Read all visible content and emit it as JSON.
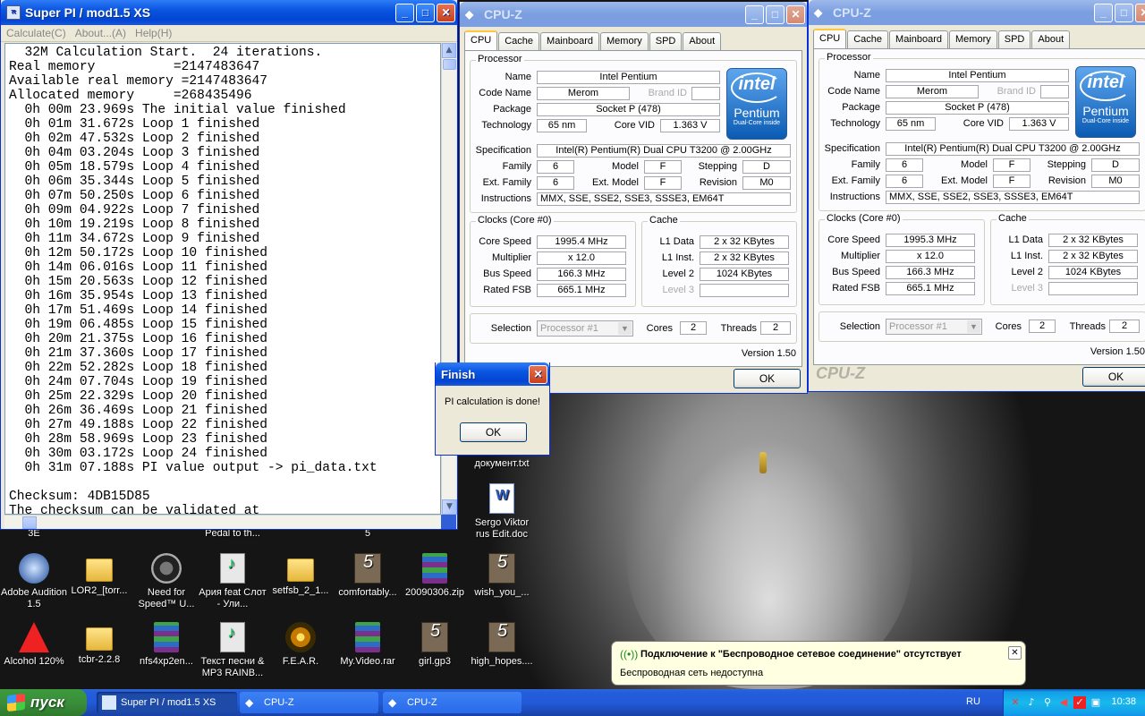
{
  "desktop": {
    "icons": [
      {
        "label": "Adobe Audition 1.5",
        "icon": "audition-icon"
      },
      {
        "label": "LOR2_[torr...",
        "icon": "folder-icon"
      },
      {
        "label": "Need for Speed™ U...",
        "icon": "nfs-icon"
      },
      {
        "label": "Ария feat Слот - Ули...",
        "icon": "mp3-icon"
      },
      {
        "label": "setfsb_2_1...",
        "icon": "folder-icon"
      },
      {
        "label": "comfortably...",
        "icon": "gp5-icon"
      },
      {
        "label": "20090306.zip",
        "icon": "rar-icon"
      },
      {
        "label": "wish_you_...",
        "icon": "gp5-icon"
      },
      {
        "label": "Alcohol 120%",
        "icon": "alcohol-icon"
      },
      {
        "label": "tcbr-2.2.8",
        "icon": "folder-icon"
      },
      {
        "label": "nfs4xp2en...",
        "icon": "rar-icon"
      },
      {
        "label": "Текст песни & MP3 RAINB...",
        "icon": "mp3-icon"
      },
      {
        "label": "F.E.A.R.",
        "icon": "fear-icon"
      },
      {
        "label": "My.Video.rar",
        "icon": "rar-icon"
      },
      {
        "label": "girl.gp3",
        "icon": "gp5-icon"
      },
      {
        "label": "high_hopes....",
        "icon": "gp5-icon"
      },
      {
        "label": "Sergo Viktor rus Edit.doc",
        "icon": "word-doc-icon"
      },
      {
        "label": "документ.txt",
        "icon": "txt-icon"
      }
    ],
    "partial_labels": [
      "3E",
      "Pedal to th...",
      "5"
    ]
  },
  "superpi": {
    "title": "Super PI / mod1.5 XS",
    "menu": [
      "Calculate(C)",
      "About...(A)",
      "Help(H)"
    ],
    "console_lines": [
      "  32M Calculation Start.  24 iterations.",
      "Real memory          =2147483647",
      "Available real memory =2147483647",
      "Allocated memory     =268435496",
      "  0h 00m 23.969s The initial value finished",
      "  0h 01m 31.672s Loop 1 finished",
      "  0h 02m 47.532s Loop 2 finished",
      "  0h 04m 03.204s Loop 3 finished",
      "  0h 05m 18.579s Loop 4 finished",
      "  0h 06m 35.344s Loop 5 finished",
      "  0h 07m 50.250s Loop 6 finished",
      "  0h 09m 04.922s Loop 7 finished",
      "  0h 10m 19.219s Loop 8 finished",
      "  0h 11m 34.672s Loop 9 finished",
      "  0h 12m 50.172s Loop 10 finished",
      "  0h 14m 06.016s Loop 11 finished",
      "  0h 15m 20.563s Loop 12 finished",
      "  0h 16m 35.954s Loop 13 finished",
      "  0h 17m 51.469s Loop 14 finished",
      "  0h 19m 06.485s Loop 15 finished",
      "  0h 20m 21.375s Loop 16 finished",
      "  0h 21m 37.360s Loop 17 finished",
      "  0h 22m 52.282s Loop 18 finished",
      "  0h 24m 07.704s Loop 19 finished",
      "  0h 25m 22.329s Loop 20 finished",
      "  0h 26m 36.469s Loop 21 finished",
      "  0h 27m 49.188s Loop 22 finished",
      "  0h 28m 58.969s Loop 23 finished",
      "  0h 30m 03.172s Loop 24 finished",
      "  0h 31m 07.188s PI value output -> pi_data.txt",
      "",
      "Checksum: 4DB15D85",
      "The checksum can be validated at"
    ]
  },
  "finish_dialog": {
    "title": "Finish",
    "message": "PI calculation is done!",
    "ok_label": "OK"
  },
  "cpuz_windows": [
    {
      "title": "CPU-Z",
      "tabs": [
        "CPU",
        "Cache",
        "Mainboard",
        "Memory",
        "SPD",
        "About"
      ],
      "processor": {
        "group_title": "Processor",
        "name_label": "Name",
        "name": "Intel Pentium",
        "code_name_label": "Code Name",
        "code_name": "Merom",
        "brand_id_label": "Brand ID",
        "brand_id": "",
        "package_label": "Package",
        "package": "Socket P (478)",
        "technology_label": "Technology",
        "technology": "65 nm",
        "core_vid_label": "Core VID",
        "core_vid": "1.363 V",
        "specification_label": "Specification",
        "specification": "Intel(R) Pentium(R) Dual  CPU  T3200  @ 2.00GHz",
        "family_label": "Family",
        "family": "6",
        "model_label": "Model",
        "model": "F",
        "stepping_label": "Stepping",
        "stepping": "D",
        "ext_family_label": "Ext. Family",
        "ext_family": "6",
        "ext_model_label": "Ext. Model",
        "ext_model": "F",
        "revision_label": "Revision",
        "revision": "M0",
        "instructions_label": "Instructions",
        "instructions": "MMX, SSE, SSE2, SSE3, SSSE3, EM64T",
        "logo": {
          "word": "intel",
          "brand": "Pentium",
          "sub": "Dual-Core inside"
        }
      },
      "clocks": {
        "group_title": "Clocks (Core #0)",
        "core_speed_label": "Core Speed",
        "core_speed": "1995.4 MHz",
        "multiplier_label": "Multiplier",
        "multiplier": "x 12.0",
        "bus_speed_label": "Bus Speed",
        "bus_speed": "166.3 MHz",
        "rated_fsb_label": "Rated FSB",
        "rated_fsb": "665.1 MHz"
      },
      "cache": {
        "group_title": "Cache",
        "l1_data_label": "L1 Data",
        "l1_data": "2 x 32 KBytes",
        "l1_inst_label": "L1 Inst.",
        "l1_inst": "2 x 32 KBytes",
        "level2_label": "Level 2",
        "level2": "1024 KBytes",
        "level3_label": "Level 3",
        "level3": ""
      },
      "selection_label": "Selection",
      "selection": "Processor #1",
      "cores_label": "Cores",
      "cores": "2",
      "threads_label": "Threads",
      "threads": "2",
      "version": "Version 1.50",
      "footer_logo": "",
      "ok_label": "OK"
    },
    {
      "title": "CPU-Z",
      "tabs": [
        "CPU",
        "Cache",
        "Mainboard",
        "Memory",
        "SPD",
        "About"
      ],
      "processor": {
        "group_title": "Processor",
        "name_label": "Name",
        "name": "Intel Pentium",
        "code_name_label": "Code Name",
        "code_name": "Merom",
        "brand_id_label": "Brand ID",
        "brand_id": "",
        "package_label": "Package",
        "package": "Socket P (478)",
        "technology_label": "Technology",
        "technology": "65 nm",
        "core_vid_label": "Core VID",
        "core_vid": "1.363 V",
        "specification_label": "Specification",
        "specification": "Intel(R) Pentium(R) Dual  CPU  T3200  @ 2.00GHz",
        "family_label": "Family",
        "family": "6",
        "model_label": "Model",
        "model": "F",
        "stepping_label": "Stepping",
        "stepping": "D",
        "ext_family_label": "Ext. Family",
        "ext_family": "6",
        "ext_model_label": "Ext. Model",
        "ext_model": "F",
        "revision_label": "Revision",
        "revision": "M0",
        "instructions_label": "Instructions",
        "instructions": "MMX, SSE, SSE2, SSE3, SSSE3, EM64T",
        "logo": {
          "word": "intel",
          "brand": "Pentium",
          "sub": "Dual-Core inside"
        }
      },
      "clocks": {
        "group_title": "Clocks (Core #0)",
        "core_speed_label": "Core Speed",
        "core_speed": "1995.3 MHz",
        "multiplier_label": "Multiplier",
        "multiplier": "x 12.0",
        "bus_speed_label": "Bus Speed",
        "bus_speed": "166.3 MHz",
        "rated_fsb_label": "Rated FSB",
        "rated_fsb": "665.1 MHz"
      },
      "cache": {
        "group_title": "Cache",
        "l1_data_label": "L1 Data",
        "l1_data": "2 x 32 KBytes",
        "l1_inst_label": "L1 Inst.",
        "l1_inst": "2 x 32 KBytes",
        "level2_label": "Level 2",
        "level2": "1024 KBytes",
        "level3_label": "Level 3",
        "level3": ""
      },
      "selection_label": "Selection",
      "selection": "Processor #1",
      "cores_label": "Cores",
      "cores": "2",
      "threads_label": "Threads",
      "threads": "2",
      "version": "Version 1.50",
      "footer_logo": "CPU-Z",
      "ok_label": "OK"
    }
  ],
  "balloon": {
    "title": "Подключение к \"Беспроводное сетевое соединение\" отсутствует",
    "text": "Беспроводная сеть недоступна"
  },
  "taskbar": {
    "start_label": "пуск",
    "tasks": [
      {
        "label": "Super PI / mod1.5 XS",
        "active": true
      },
      {
        "label": "CPU-Z",
        "active": false
      },
      {
        "label": "CPU-Z",
        "active": false
      }
    ],
    "language": "RU",
    "clock": "10:38"
  },
  "colors": {
    "titlebar_active": "#0a55e0",
    "titlebar_inactive": "#7a9ee0",
    "window_bg": "#ece9d8",
    "taskbar": "#245edc",
    "start_button": "#3a8e3a",
    "tray": "#18b9ed"
  }
}
